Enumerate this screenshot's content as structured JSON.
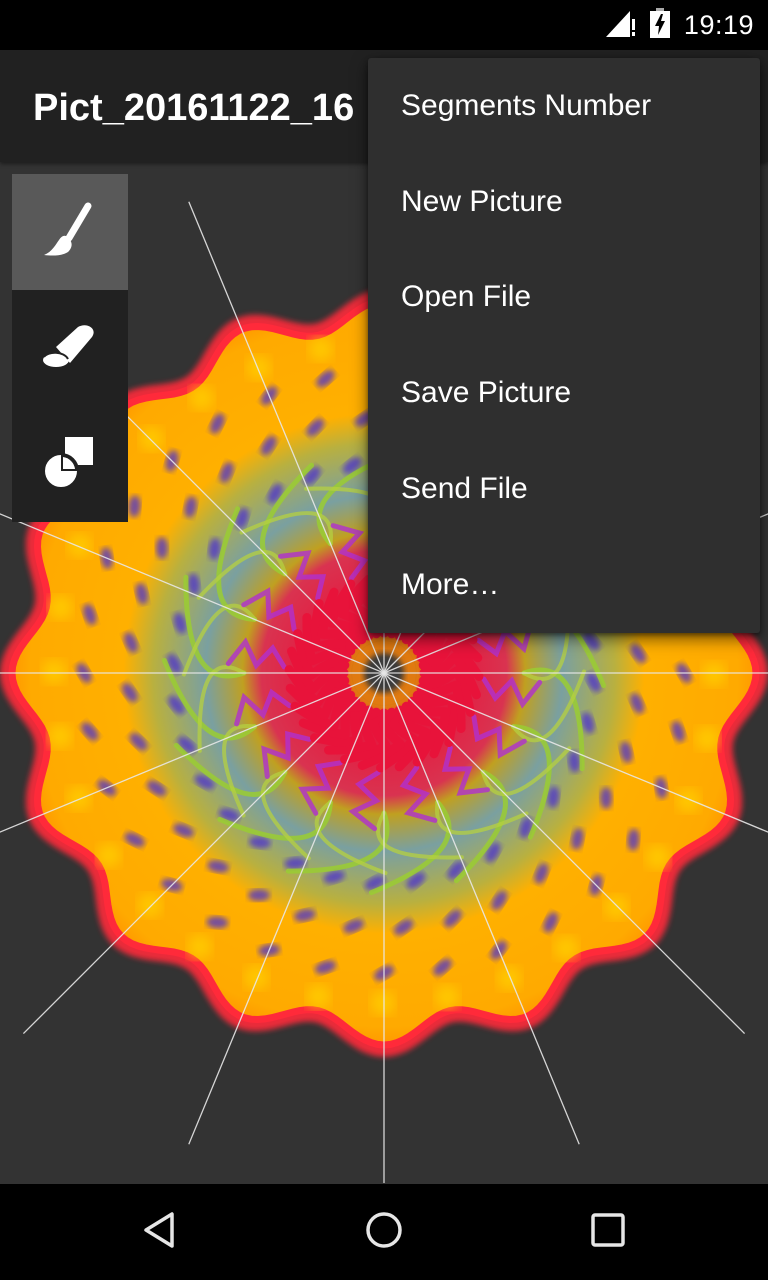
{
  "status_bar": {
    "time": "19:19",
    "icons": [
      "signal-no-data-icon",
      "battery-charging-icon"
    ]
  },
  "app_bar": {
    "title": "Pict_20161122_16"
  },
  "toolbox": {
    "tools": [
      {
        "name": "brush",
        "icon": "paintbrush-icon",
        "active": true
      },
      {
        "name": "eraser",
        "icon": "eraser-icon",
        "active": false
      },
      {
        "name": "shapes",
        "icon": "shapes-icon",
        "active": false
      }
    ]
  },
  "canvas": {
    "segments": 16,
    "background_color": "#333333",
    "guide_line_color": "#e8e8e8",
    "palette": {
      "outer_rim": "#ff2a3a",
      "outer_fill": "#ffb000",
      "spots": "#4a2fd0",
      "middle_ring": "#9acd32",
      "inner_ring": "#e8133a",
      "center": "#e07a10"
    }
  },
  "overflow_menu": {
    "items": [
      {
        "label": "Segments Number"
      },
      {
        "label": "New Picture"
      },
      {
        "label": "Open File"
      },
      {
        "label": "Save Picture"
      },
      {
        "label": "Send File"
      },
      {
        "label": "More…"
      }
    ]
  },
  "nav_bar": {
    "buttons": [
      "back",
      "home",
      "recents"
    ]
  }
}
